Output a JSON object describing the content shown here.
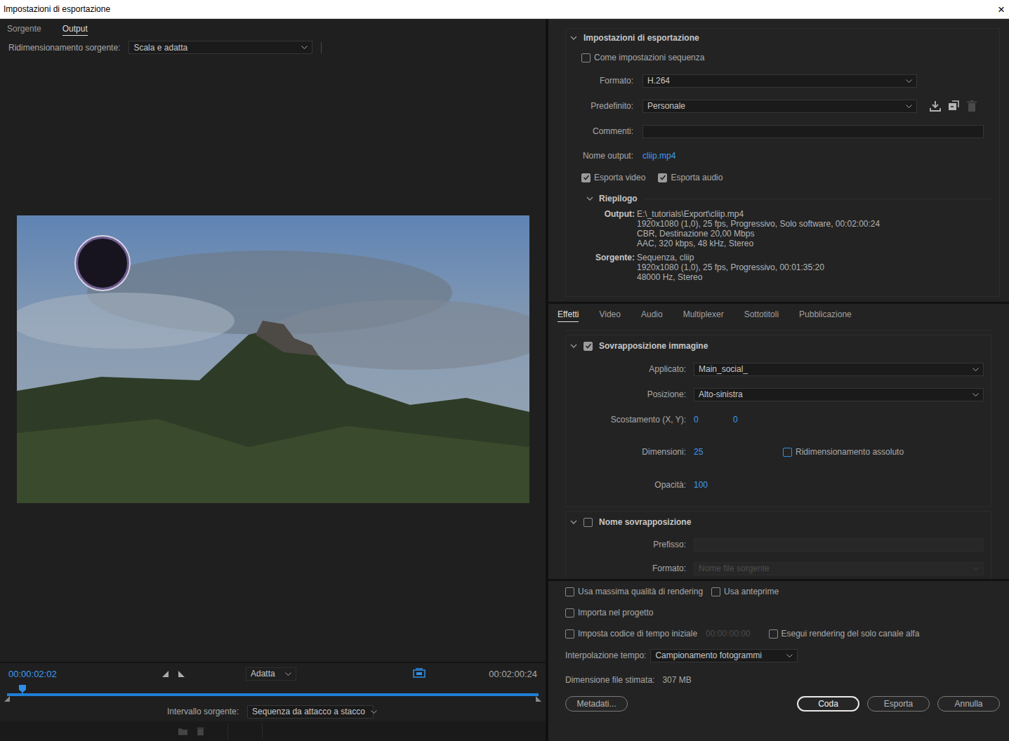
{
  "window": {
    "title": "Impostazioni di esportazione",
    "close": "×"
  },
  "preview": {
    "tabs": [
      {
        "label": "Sorgente",
        "selected": false
      },
      {
        "label": "Output",
        "selected": true
      }
    ],
    "source_scaling": {
      "label": "Ridimensionamento sorgente:",
      "value": "Scala e adatta"
    },
    "transport": {
      "current_time": "00:00:02:02",
      "zoom": "Adatta",
      "duration": "00:02:00:24",
      "level": 0.017
    },
    "source_range": {
      "label": "Intervallo sorgente:",
      "value": "Sequenza da attacco a stacco"
    }
  },
  "export_settings": {
    "title": "Impostazioni di esportazione",
    "expanded": true,
    "match_sequence": {
      "label": "Come impostazioni sequenza",
      "checked": false
    },
    "format": {
      "label": "Formato:",
      "value": "H.264"
    },
    "preset": {
      "label": "Predefinito:",
      "value": "Personale",
      "actions": [
        {
          "disabled": false
        },
        {
          "disabled": false
        },
        {
          "disabled": true
        }
      ]
    },
    "comments": {
      "label": "Commenti:",
      "value": ""
    },
    "output_name": {
      "label": "Nome output:",
      "value": "cliip.mp4"
    },
    "export_toggles": [
      {
        "label": "Esporta video",
        "checked": true
      },
      {
        "label": "Esporta audio",
        "checked": true
      }
    ],
    "summary": {
      "title": "Riepilogo",
      "expanded": true,
      "groups": [
        {
          "label": "Output:",
          "lines": [
            "E:\\_tutorials\\Export\\cliip.mp4",
            "1920x1080 (1,0), 25 fps, Progressivo, Solo software, 00:02:00:24",
            "CBR, Destinazione 20,00 Mbps",
            "AAC, 320 kbps, 48 kHz, Stereo"
          ]
        },
        {
          "label": "Sorgente:",
          "lines": [
            "Sequenza, cliip",
            "1920x1080 (1,0), 25 fps, Progressivo, 00:01:35:20",
            "48000 Hz, Stereo"
          ]
        }
      ]
    }
  },
  "settings_tabs": [
    {
      "label": "Effetti",
      "selected": true
    },
    {
      "label": "Video",
      "selected": false
    },
    {
      "label": "Audio",
      "selected": false
    },
    {
      "label": "Multiplexer",
      "selected": false
    },
    {
      "label": "Sottotitoli",
      "selected": false
    },
    {
      "label": "Pubblicazione",
      "selected": false
    }
  ],
  "effects": [
    {
      "title": "Sovrapposizione immagine",
      "checked": true,
      "expanded": true,
      "rows": [
        {
          "kind": "select",
          "label": "Applicato:",
          "value": "Main_social_",
          "disabled": false
        },
        {
          "kind": "select",
          "label": "Posizione:",
          "value": "Alto-sinistra",
          "disabled": false
        },
        {
          "kind": "pair",
          "label": "Scostamento (X, Y):",
          "values": [
            "0",
            "0"
          ],
          "disabled": false
        },
        {
          "kind": "number-check",
          "label": "Dimensioni:",
          "value": "25",
          "disabled": false,
          "checkbox": {
            "label": "Ridimensionamento assoluto",
            "checked": false,
            "focused": true
          }
        },
        {
          "kind": "number",
          "label": "Opacità:",
          "value": "100",
          "disabled": false
        }
      ]
    },
    {
      "title": "Nome sovrapposizione",
      "checked": false,
      "expanded": true,
      "rows": [
        {
          "kind": "field",
          "label": "Prefisso:",
          "value": "",
          "disabled": true
        },
        {
          "kind": "select",
          "label": "Formato:",
          "value": "Nome file sorgente",
          "disabled": true
        }
      ]
    }
  ],
  "options": {
    "rows": [
      [
        {
          "label": "Usa massima qualità di rendering",
          "checked": false
        },
        {
          "label": "Usa anteprime",
          "checked": false
        }
      ],
      [
        {
          "label": "Importa nel progetto",
          "checked": false
        }
      ],
      [
        {
          "label": "Imposta codice di tempo iniziale",
          "checked": false,
          "timecode": {
            "value": "00:00:00:00",
            "disabled": true
          }
        },
        {
          "label": "Esegui rendering del solo canale alfa",
          "checked": false
        }
      ]
    ],
    "interpolation": {
      "label": "Interpolazione tempo:",
      "value": "Campionamento fotogrammi"
    },
    "file_size": {
      "label": "Dimensione file stimata:",
      "value": "307 MB"
    }
  },
  "buttons": [
    {
      "label": "Metadati...",
      "focused": false
    },
    {
      "label": "Coda",
      "focused": true
    },
    {
      "label": "Esporta",
      "focused": false
    },
    {
      "label": "Annulla",
      "focused": false
    }
  ]
}
